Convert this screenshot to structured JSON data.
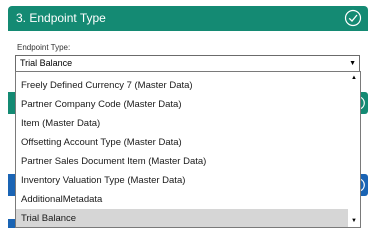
{
  "step": {
    "title": "3. Endpoint Type",
    "status_icon": "check-circle-icon"
  },
  "field": {
    "label": "Endpoint Type:",
    "selected_value": "Trial Balance"
  },
  "dropdown": {
    "options": [
      "Freely Defined Currency 7 (Master Data)",
      "Partner Company Code (Master Data)",
      "Item (Master Data)",
      "Offsetting Account Type (Master Data)",
      "Partner Sales Document Item (Master Data)",
      "Inventory Valuation Type (Master Data)",
      "AdditionalMetadata",
      "Trial Balance"
    ],
    "selected_index": 7
  },
  "colors": {
    "step_header_bg": "#148a73",
    "step_header_text": "#ffffff",
    "next_step_blue": "#1a64b4",
    "selected_option_bg": "#d6d6d6"
  }
}
